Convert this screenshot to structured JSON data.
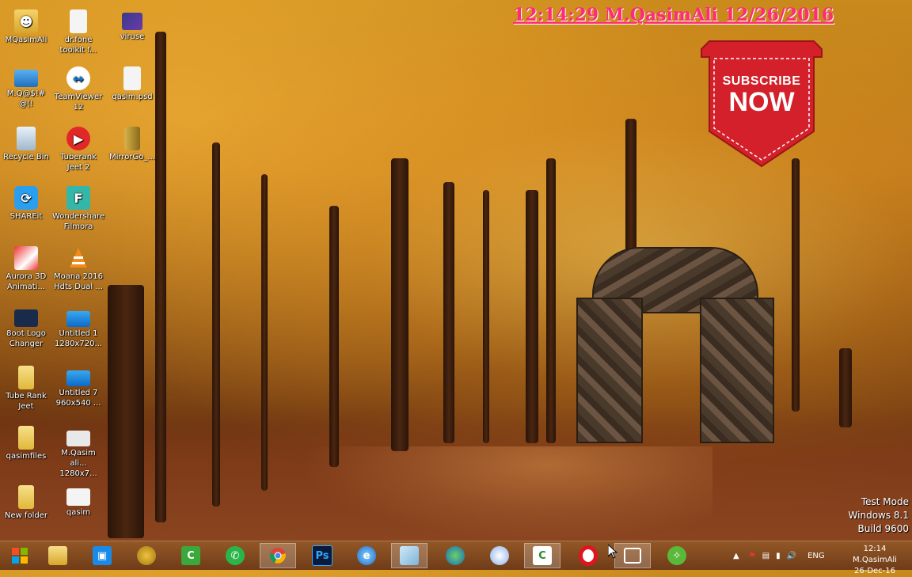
{
  "overlay": {
    "clock_text": "12:14:29 M.QasimAli 12/26/2016",
    "banner_line1": "SUBSCRIBE",
    "banner_line2": "NOW",
    "banner_color": "#d3202a"
  },
  "desktop_icons": [
    {
      "label": "MQasimAli",
      "icon": "user-folder-icon"
    },
    {
      "label": "dr.fone toolkit f...",
      "icon": "file-icon"
    },
    {
      "label": "viruse",
      "icon": "video-file-icon"
    },
    {
      "label": "M.Q@$!# @(!",
      "icon": "computer-icon"
    },
    {
      "label": "TeamViewer 12",
      "icon": "teamviewer-icon"
    },
    {
      "label": "qasim.psd",
      "icon": "file-icon"
    },
    {
      "label": "Recycle Bin",
      "icon": "recycle-bin-icon"
    },
    {
      "label": "Tuberank Jeet 2",
      "icon": "tuberank-icon"
    },
    {
      "label": "MirrorGo_...",
      "icon": "archive-icon"
    },
    {
      "label": "SHAREit",
      "icon": "shareit-icon"
    },
    {
      "label": "Wondershare Filmora",
      "icon": "filmora-icon"
    },
    {
      "label": "Aurora 3D Animati...",
      "icon": "aurora-3d-icon"
    },
    {
      "label": "Moana 2016 Hdts Dual ...",
      "icon": "vlc-icon"
    },
    {
      "label": "8oot Logo Changer",
      "icon": "boot-logo-icon"
    },
    {
      "label": "Untitled 1 1280x720...",
      "icon": "image-file-icon"
    },
    {
      "label": "Tube Rank Jeet",
      "icon": "folder-icon"
    },
    {
      "label": "Untitled 7 960x540 ...",
      "icon": "image-file-icon"
    },
    {
      "label": "qasimfiles",
      "icon": "folder-icon"
    },
    {
      "label": "M.Qasim ali... 1280x7...",
      "icon": "image-file-icon"
    },
    {
      "label": "New folder",
      "icon": "folder-icon"
    },
    {
      "label": "qasim",
      "icon": "text-file-icon"
    }
  ],
  "watermark": {
    "line1": "Test Mode",
    "line2": "Windows 8.1",
    "line3": "Build 9600"
  },
  "taskbar": {
    "apps": [
      {
        "name": "start",
        "icon": "windows-start-icon"
      },
      {
        "name": "file-explorer",
        "icon": "file-explorer-icon"
      },
      {
        "name": "snipping",
        "icon": "capture-icon"
      },
      {
        "name": "pineapple",
        "icon": "pineapple-icon"
      },
      {
        "name": "camtasia-recorder",
        "icon": "camtasia-icon"
      },
      {
        "name": "whatsapp",
        "icon": "whatsapp-icon"
      },
      {
        "name": "chrome",
        "icon": "chrome-icon"
      },
      {
        "name": "photoshop",
        "icon": "photoshop-icon",
        "text": "Ps"
      },
      {
        "name": "ie",
        "icon": "internet-explorer-icon"
      },
      {
        "name": "notepad",
        "icon": "notepad-icon"
      },
      {
        "name": "globe",
        "icon": "globe-icon"
      },
      {
        "name": "media",
        "icon": "media-icon"
      },
      {
        "name": "camtasia",
        "icon": "camtasia-studio-icon"
      },
      {
        "name": "opera",
        "icon": "opera-icon"
      },
      {
        "name": "task-view",
        "icon": "window-app-icon"
      },
      {
        "name": "feather",
        "icon": "feather-icon"
      }
    ],
    "tray": {
      "lang": "ENG",
      "time": "12:14 M.QasimAli",
      "date": "26-Dec-16"
    }
  }
}
